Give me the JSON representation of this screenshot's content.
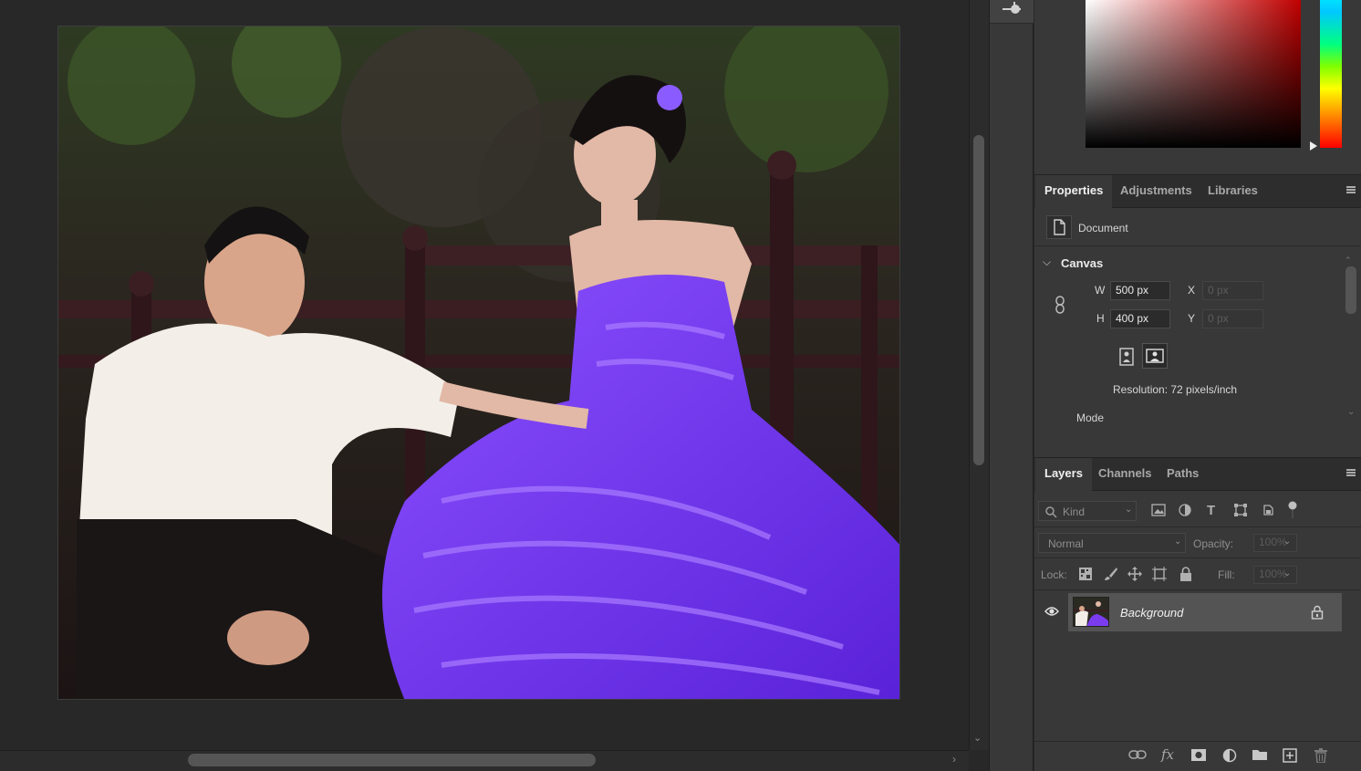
{
  "canvas": {
    "image_desc": "",
    "vscroll_down": "⌄",
    "hscroll_right": "›"
  },
  "properties_panel": {
    "tabs": [
      {
        "label": "Properties",
        "active": true
      },
      {
        "label": "Adjustments",
        "active": false
      },
      {
        "label": "Libraries",
        "active": false
      }
    ],
    "document_label": "Document",
    "section_title": "Canvas",
    "width_label": "W",
    "width_value": "500 px",
    "height_label": "H",
    "height_value": "400 px",
    "x_label": "X",
    "x_placeholder": "0 px",
    "y_label": "Y",
    "y_placeholder": "0 px",
    "resolution": "Resolution: 72 pixels/inch",
    "mode_label": "Mode"
  },
  "layers_panel": {
    "tabs": [
      {
        "label": "Layers",
        "active": true
      },
      {
        "label": "Channels",
        "active": false
      },
      {
        "label": "Paths",
        "active": false
      }
    ],
    "filter_placeholder": "Kind",
    "blend_mode": "Normal",
    "opacity_label": "Opacity:",
    "opacity_value": "100%",
    "lock_label": "Lock:",
    "fill_label": "Fill:",
    "fill_value": "100%",
    "layers": [
      {
        "name": "Background",
        "visible": true,
        "locked": true
      }
    ]
  },
  "colors": {
    "accent_dress": "#7b3cf0",
    "panel_bg": "#383838",
    "workspace_bg": "#282828"
  }
}
